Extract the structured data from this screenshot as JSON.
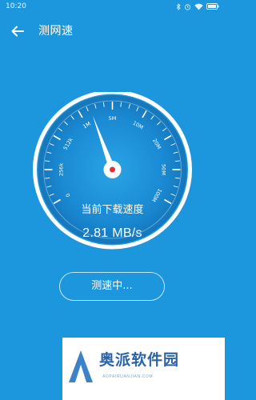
{
  "status_bar": {
    "time": "10:20",
    "icons": [
      "bluetooth-icon",
      "alarm-icon",
      "wifi-icon",
      "battery-icon"
    ]
  },
  "header": {
    "back_icon": "back-arrow-icon",
    "title": "测网速"
  },
  "gauge": {
    "scale_labels": [
      "0",
      "256k",
      "512k",
      "1M",
      "5M",
      "10M",
      "20M",
      "50M",
      "100M"
    ],
    "needle_value": "1M",
    "colors": {
      "ring": "#ffffff",
      "face": "#1a86cc",
      "needle": "#ffffff",
      "hub_dot": "#e0303a"
    }
  },
  "speed": {
    "caption": "当前下载速度",
    "value": "2.81 MB/s"
  },
  "action": {
    "button_label": "测速中..."
  },
  "watermark": {
    "text": "奥派软件园",
    "subtext": "AOPAIRUANJIAN.COM"
  },
  "colors": {
    "background": "#1c97de",
    "watermark_text": "#2a63a6"
  }
}
